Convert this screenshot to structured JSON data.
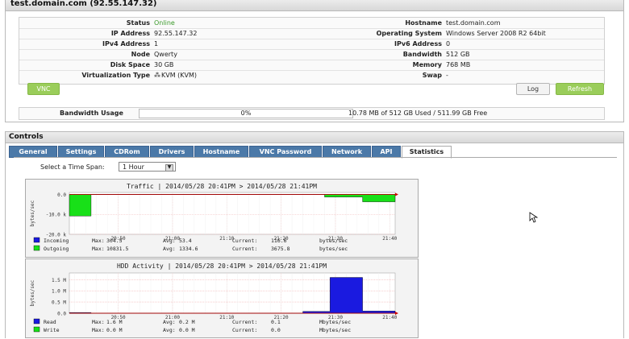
{
  "server": {
    "title": "test.domain.com (92.55.147.32)",
    "left": [
      {
        "label": "Status",
        "value": "Online"
      },
      {
        "label": "IP Address",
        "value": "92.55.147.32"
      },
      {
        "label": "IPv4 Address",
        "value": "1"
      },
      {
        "label": "Node",
        "value": "Qwerty"
      },
      {
        "label": "Disk Space",
        "value": "30 GB"
      },
      {
        "label": "Virtualization Type",
        "value": "KVM (KVM)"
      }
    ],
    "right": [
      {
        "label": "Hostname",
        "value": "test.domain.com"
      },
      {
        "label": "Operating System",
        "value": "Windows Server 2008 R2 64bit"
      },
      {
        "label": "IPv6 Address",
        "value": "0"
      },
      {
        "label": "Bandwidth",
        "value": "512 GB"
      },
      {
        "label": "Memory",
        "value": "768 MB"
      },
      {
        "label": "Swap",
        "value": "-"
      }
    ],
    "buttons": {
      "vnc": "VNC",
      "log": "Log",
      "refresh": "Refresh"
    },
    "bandwidth": {
      "label": "Bandwidth Usage",
      "percent": "0%",
      "percent_value": 0,
      "summary": "10.78 MB of 512 GB Used / 511.99 GB Free"
    }
  },
  "controls": {
    "title": "Controls",
    "tabs": [
      "General",
      "Settings",
      "CDRom",
      "Drivers",
      "Hostname",
      "VNC Password",
      "Network",
      "API",
      "Statistics"
    ],
    "active_tab": "Statistics",
    "timespan": {
      "label": "Select a Time Span:",
      "value": "1 Hour"
    }
  },
  "colors": {
    "incoming": "#1a1ae0",
    "outgoing": "#18e018",
    "read": "#1a1ae0",
    "write": "#18e018",
    "accent": "#4b79a8",
    "refresh": "#9acd5a"
  },
  "chart_data": [
    {
      "type": "area",
      "title": "Traffic | 2014/05/28 20:41PM > 2014/05/28 21:41PM",
      "ylabel": "bytes/sec",
      "y_ticks": [
        "0.0",
        "-10.0 k",
        "-20.0 k"
      ],
      "ylim": [
        -20000,
        1000
      ],
      "x_ticks": [
        "20:50",
        "21:00",
        "21:10",
        "21:20",
        "21:30",
        "21:40"
      ],
      "x_range": [
        "20:41",
        "21:41"
      ],
      "grid": true,
      "series": [
        {
          "name": "Incoming",
          "stats": {
            "max_label": "Max:",
            "max": "304.5",
            "avg_label": "Avg:",
            "avg": "53.4",
            "current_label": "Current:",
            "current": "116.6",
            "unit": "bytes/sec"
          },
          "points": [
            [
              "20:41",
              0
            ],
            [
              "20:45",
              0
            ],
            [
              "21:28",
              0
            ],
            [
              "21:41",
              0
            ]
          ]
        },
        {
          "name": "Outgoing",
          "stats": {
            "max_label": "Max:",
            "max": "10831.5",
            "avg_label": "Avg:",
            "avg": "1334.6",
            "current_label": "Current:",
            "current": "3675.8",
            "unit": "bytes/sec"
          },
          "points": [
            [
              "20:41",
              -10800
            ],
            [
              "20:45",
              -10800
            ],
            [
              "20:45",
              0
            ],
            [
              "21:28",
              0
            ],
            [
              "21:28",
              -1300
            ],
            [
              "21:35",
              -1300
            ],
            [
              "21:35",
              -3700
            ],
            [
              "21:41",
              -3700
            ]
          ]
        }
      ]
    },
    {
      "type": "area",
      "title": "HDD Activity | 2014/05/28 20:41PM > 2014/05/28 21:41PM",
      "ylabel": "bytes/sec",
      "y_ticks": [
        "1.5 M",
        "1.0 M",
        "0.5 M",
        "0.0"
      ],
      "ylim": [
        0,
        1800000
      ],
      "x_ticks": [
        "20:50",
        "21:00",
        "21:10",
        "21:20",
        "21:30",
        "21:40"
      ],
      "x_range": [
        "20:41",
        "21:41"
      ],
      "grid": true,
      "series": [
        {
          "name": "Read",
          "stats": {
            "max_label": "Max:",
            "max": "1.6 M",
            "avg_label": "Avg:",
            "avg": "0.2 M",
            "current_label": "Current:",
            "current": "0.1",
            "unit": "Mbytes/sec"
          },
          "points": [
            [
              "20:41",
              30000
            ],
            [
              "20:45",
              30000
            ],
            [
              "20:45",
              0
            ],
            [
              "21:24",
              0
            ],
            [
              "21:24",
              80000
            ],
            [
              "21:29",
              80000
            ],
            [
              "21:29",
              1600000
            ],
            [
              "21:35",
              1600000
            ],
            [
              "21:35",
              100000
            ],
            [
              "21:41",
              100000
            ]
          ]
        },
        {
          "name": "Write",
          "stats": {
            "max_label": "Max:",
            "max": "0.0 M",
            "avg_label": "Avg:",
            "avg": "0.0 M",
            "current_label": "Current:",
            "current": "0.0",
            "unit": "Mbytes/sec"
          },
          "points": [
            [
              "20:41",
              0
            ],
            [
              "21:41",
              0
            ]
          ]
        }
      ]
    }
  ]
}
